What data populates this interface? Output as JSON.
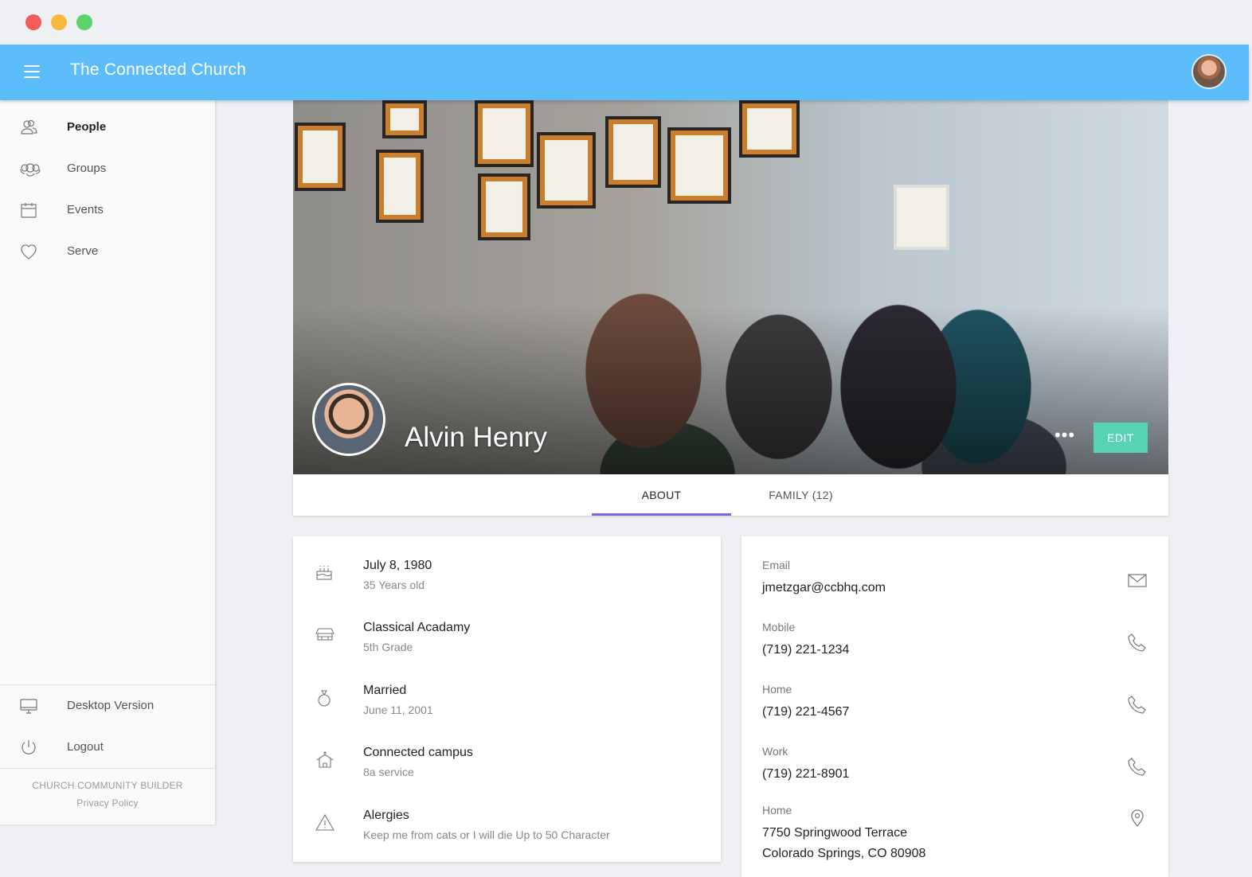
{
  "header": {
    "title": "The Connected Church"
  },
  "sidebar": {
    "items": [
      {
        "label": "People",
        "icon": "people-icon",
        "active": true
      },
      {
        "label": "Groups",
        "icon": "groups-icon",
        "active": false
      },
      {
        "label": "Events",
        "icon": "calendar-icon",
        "active": false
      },
      {
        "label": "Serve",
        "icon": "heart-icon",
        "active": false
      }
    ],
    "bottom": [
      {
        "label": "Desktop Version",
        "icon": "monitor-icon"
      },
      {
        "label": "Logout",
        "icon": "power-icon"
      }
    ],
    "footer": {
      "brand": "CHURCH COMMUNITY BUILDER",
      "privacy": "Privacy Policy"
    }
  },
  "profile": {
    "name": "Alvin Henry",
    "more": "•••",
    "edit": "EDIT"
  },
  "tabs": [
    {
      "label": "ABOUT",
      "active": true
    },
    {
      "label": "FAMILY (12)",
      "active": false
    }
  ],
  "about": [
    {
      "primary": "July 8, 1980",
      "secondary": "35 Years old",
      "icon": "cake-icon"
    },
    {
      "primary": "Classical Acadamy",
      "secondary": "5th Grade",
      "icon": "school-icon"
    },
    {
      "primary": "Married",
      "secondary": "June 11, 2001",
      "icon": "ring-icon"
    },
    {
      "primary": "Connected campus",
      "secondary": "8a service",
      "icon": "church-icon"
    },
    {
      "primary": "Alergies",
      "secondary": "Keep me from cats or I will die Up to 50 Character",
      "icon": "warning-icon"
    }
  ],
  "contact": [
    {
      "label": "Email",
      "value": "jmetzgar@ccbhq.com",
      "icon": "mail-icon"
    },
    {
      "label": "Mobile",
      "value": "(719) 221-1234",
      "icon": "phone-icon"
    },
    {
      "label": "Home",
      "value": "(719) 221-4567",
      "icon": "phone-icon"
    },
    {
      "label": "Work",
      "value": "(719) 221-8901",
      "icon": "phone-icon"
    },
    {
      "label": "Home",
      "value": "7750 Springwood Terrace",
      "value2": "Colorado Springs, CO 80908",
      "icon": "map-pin-icon"
    }
  ],
  "colors": {
    "header": "#5dbdfb",
    "accent_tab": "#8263e8",
    "edit_button": "#56d3b3"
  }
}
